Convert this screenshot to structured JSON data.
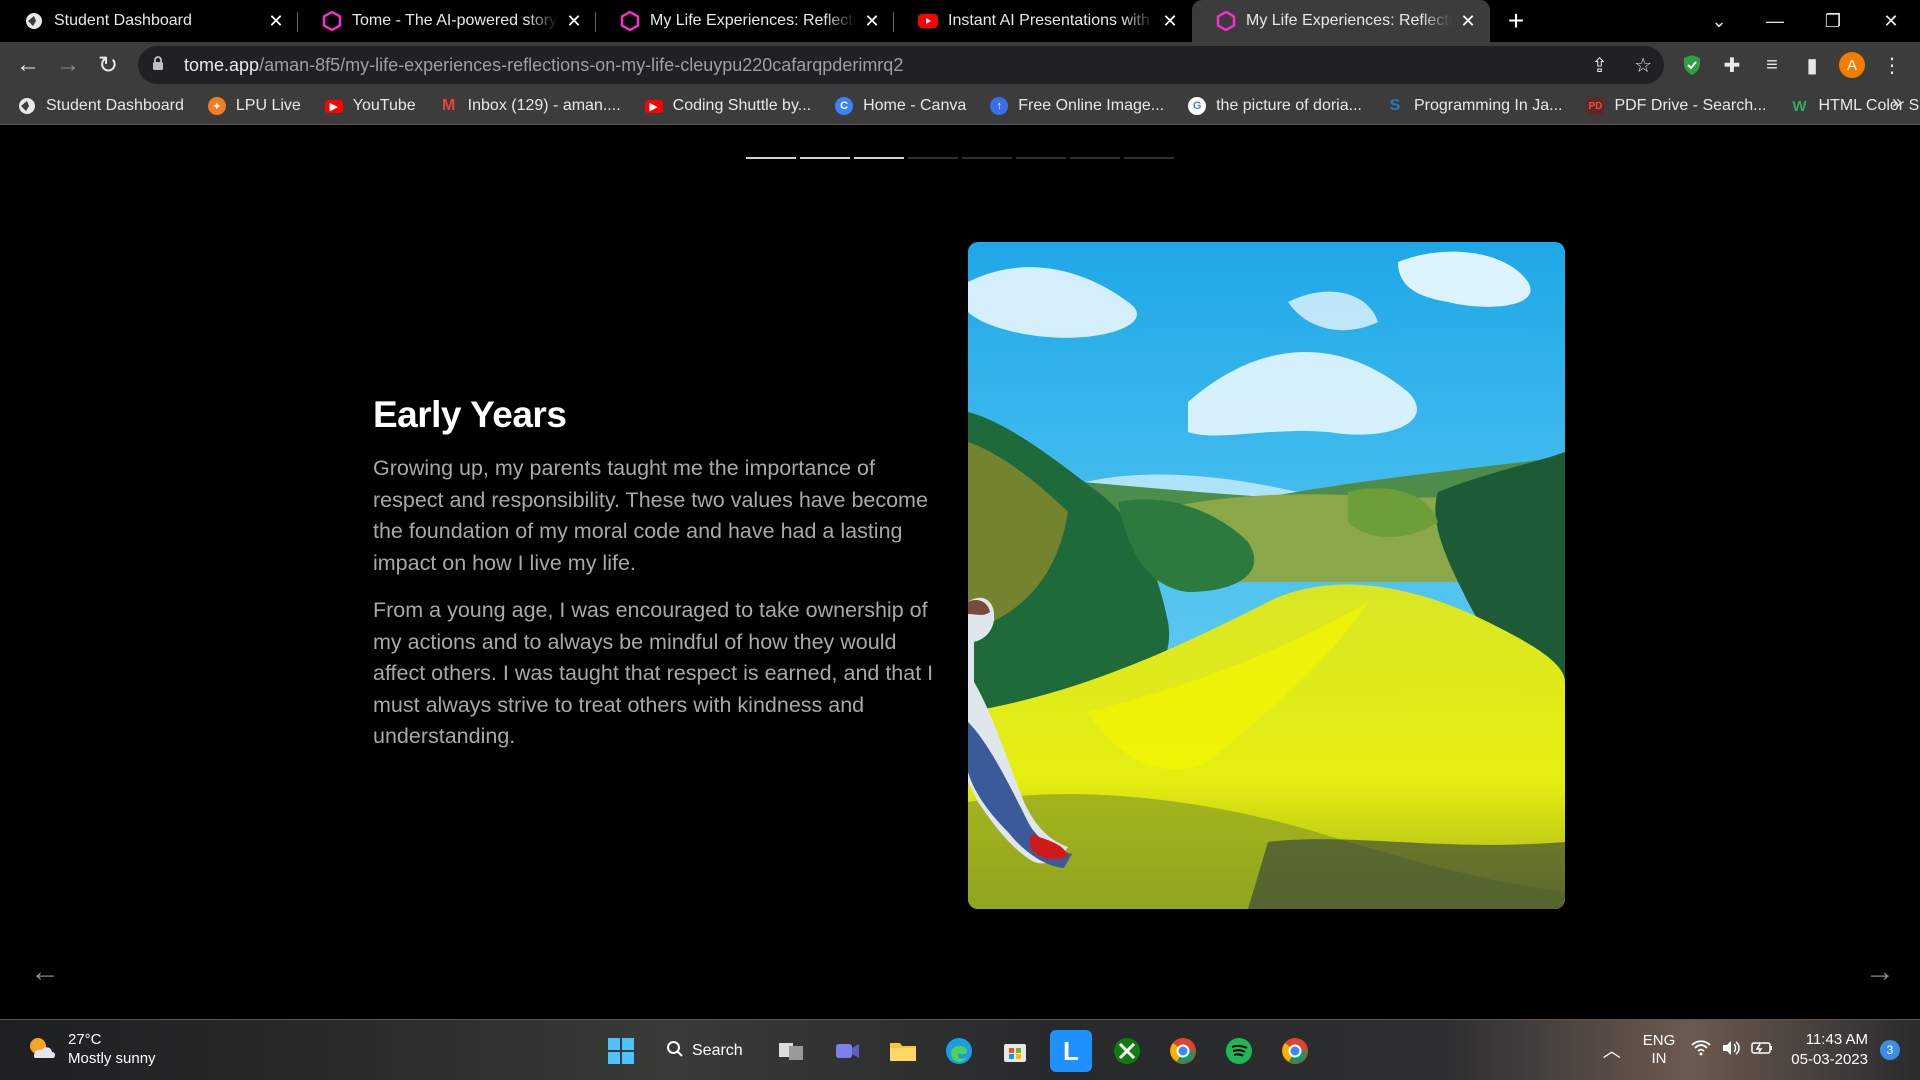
{
  "browser": {
    "tabs": [
      {
        "title": "Student Dashboard",
        "icon": "globe-icon",
        "active": false
      },
      {
        "title": "Tome - The AI-powered storytelling",
        "icon": "tome-icon",
        "active": false
      },
      {
        "title": "My Life Experiences: Reflections on My Life",
        "icon": "tome-icon",
        "active": false
      },
      {
        "title": "Instant AI Presentations with tome",
        "icon": "youtube-icon",
        "active": false
      },
      {
        "title": "My Life Experiences: Reflections on My Life",
        "icon": "tome-icon",
        "active": true
      }
    ],
    "url_host": "tome.app",
    "url_path": "/aman-8f5/my-life-experiences-reflections-on-my-life-cleuypu220cafarqpderimrq2",
    "profile_initial": "A",
    "bookmarks": [
      {
        "label": "Student Dashboard",
        "icon": "globe-icon",
        "color": "#ffffff"
      },
      {
        "label": "LPU Live",
        "icon": "lpu-icon",
        "color": "#f47c20"
      },
      {
        "label": "YouTube",
        "icon": "youtube-icon",
        "color": "#ff0000"
      },
      {
        "label": "Inbox (129) - aman....",
        "icon": "gmail-icon",
        "color": "#ea4335"
      },
      {
        "label": "Coding Shuttle by...",
        "icon": "youtube-icon",
        "color": "#ff0000"
      },
      {
        "label": "Home - Canva",
        "icon": "canva-icon",
        "color": "#00c4cc"
      },
      {
        "label": "Free Online Image...",
        "icon": "image-icon",
        "color": "#3b82f6"
      },
      {
        "label": "the picture of doria...",
        "icon": "google-icon",
        "color": "#4285f4"
      },
      {
        "label": "Programming In Ja...",
        "icon": "scribd-icon",
        "color": "#1e7bc4"
      },
      {
        "label": "PDF Drive - Search...",
        "icon": "pdf-icon",
        "color": "#c0392b"
      },
      {
        "label": "HTML Color Shades",
        "icon": "html-color-icon",
        "color": "#27ae60"
      }
    ]
  },
  "presentation": {
    "progress_segments": 8,
    "progress_done": 3,
    "title": "Early Years",
    "paragraph_1": "Growing up, my parents taught me the importance of respect and responsibility. These two values have become the foundation of my moral code and have had a lasting impact on how I live my life.",
    "paragraph_2": "From a young age, I was encouraged to take ownership of my actions and to always be mindful of how they would affect others. I was taught that respect is earned, and that I must always strive to treat others with kindness and understanding.",
    "image_subject": "painted-landscape-image"
  },
  "taskbar": {
    "temperature": "27°C",
    "weather": "Mostly sunny",
    "search_label": "Search",
    "lang_line1": "ENG",
    "lang_line2": "IN",
    "time": "11:43 AM",
    "date": "05-03-2023",
    "notification_count": "3"
  }
}
